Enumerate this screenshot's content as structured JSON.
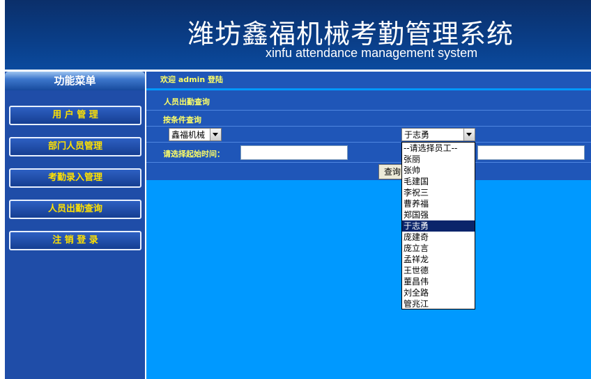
{
  "header": {
    "title": "潍坊鑫福机械考勤管理系统",
    "subtitle": "xinfu attendance management system"
  },
  "sidebar": {
    "title": "功能菜单",
    "items": [
      {
        "label": "用 户 管 理"
      },
      {
        "label": "部门人员管理"
      },
      {
        "label": "考勤录入管理"
      },
      {
        "label": "人员出勤查询"
      },
      {
        "label": "注 销 登 录"
      }
    ]
  },
  "main": {
    "welcome": "欢迎 admin 登陆",
    "section_title": "人员出勤查询",
    "filter_title": "按条件查询",
    "company_select": "鑫福机械",
    "employee_select": "于志勇",
    "start_time_label": "请选择起始时间：",
    "query_button": "查询",
    "employee_options": [
      "--请选择员工--",
      "张丽",
      "张帅",
      "毛建国",
      "李祝三",
      "曹养福",
      "郑国强",
      "于志勇",
      "庞建奇",
      "庞立言",
      "孟祥龙",
      "王世德",
      "董昌伟",
      "刘全路",
      "管兆江"
    ],
    "selected_option_index": 7
  },
  "colors": {
    "header_bg": "#0a3d86",
    "sidebar_bg": "#1f4da8",
    "main_bg": "#0099ff",
    "accent_text": "#ffff66",
    "selected_option_bg": "#0a246a"
  }
}
